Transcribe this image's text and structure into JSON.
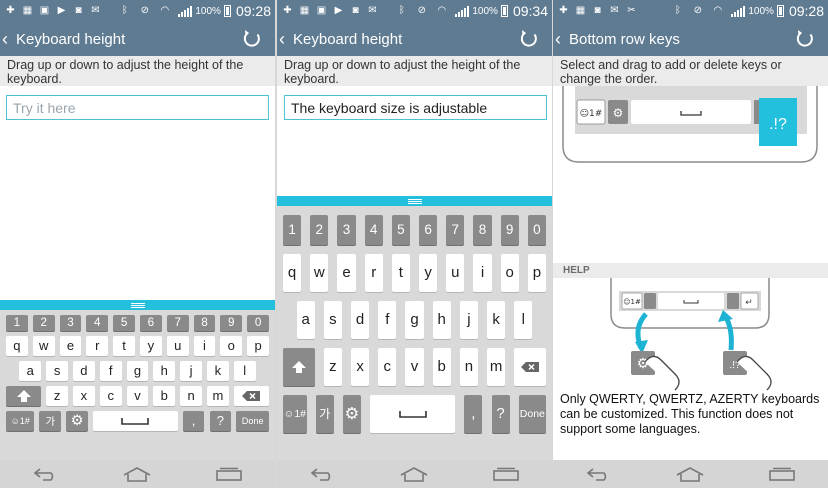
{
  "status": {
    "battery": "100%",
    "times": [
      "09:28",
      "09:34",
      "09:28"
    ]
  },
  "panels": [
    {
      "title": "Keyboard height",
      "instruction": "Drag up or down to adjust the height of the keyboard.",
      "input_value": "",
      "input_placeholder": "Try it here"
    },
    {
      "title": "Keyboard height",
      "instruction": "Drag up or down to adjust the height of the keyboard.",
      "input_value": "The keyboard size is adjustable",
      "input_placeholder": ""
    },
    {
      "title": "Bottom row keys",
      "instruction": "Select and drag to add or delete keys or change the order."
    }
  ],
  "keyboard": {
    "numbers": [
      "1",
      "2",
      "3",
      "4",
      "5",
      "6",
      "7",
      "8",
      "9",
      "0"
    ],
    "row1": [
      "q",
      "w",
      "e",
      "r",
      "t",
      "y",
      "u",
      "i",
      "o",
      "p"
    ],
    "row2": [
      "a",
      "s",
      "d",
      "f",
      "g",
      "h",
      "j",
      "k",
      "l"
    ],
    "row3": [
      "z",
      "x",
      "c",
      "v",
      "b",
      "n",
      "m"
    ],
    "row1_sub": [
      "",
      "",
      "",
      "",
      "",
      "",
      "",
      "",
      "",
      ""
    ],
    "symbols_label": "☺1#",
    "lang_label": "가",
    "comma": ",",
    "question": "?",
    "done": "Done"
  },
  "bottom_row_editor": {
    "symbols_label": "☺1#",
    "punct_label": ".!?"
  },
  "help": {
    "header": "HELP",
    "symbols_label": "☺1#",
    "punct_label": ".!?",
    "text": "Only QWERTY, QWERTZ, AZERTY keyboards can be customized. This function does not support some languages."
  },
  "colors": {
    "bar": "#5f7b92",
    "accent": "#22c0dd",
    "input_border": "#4cc2d3",
    "dark_key": "#8a8a8a"
  }
}
